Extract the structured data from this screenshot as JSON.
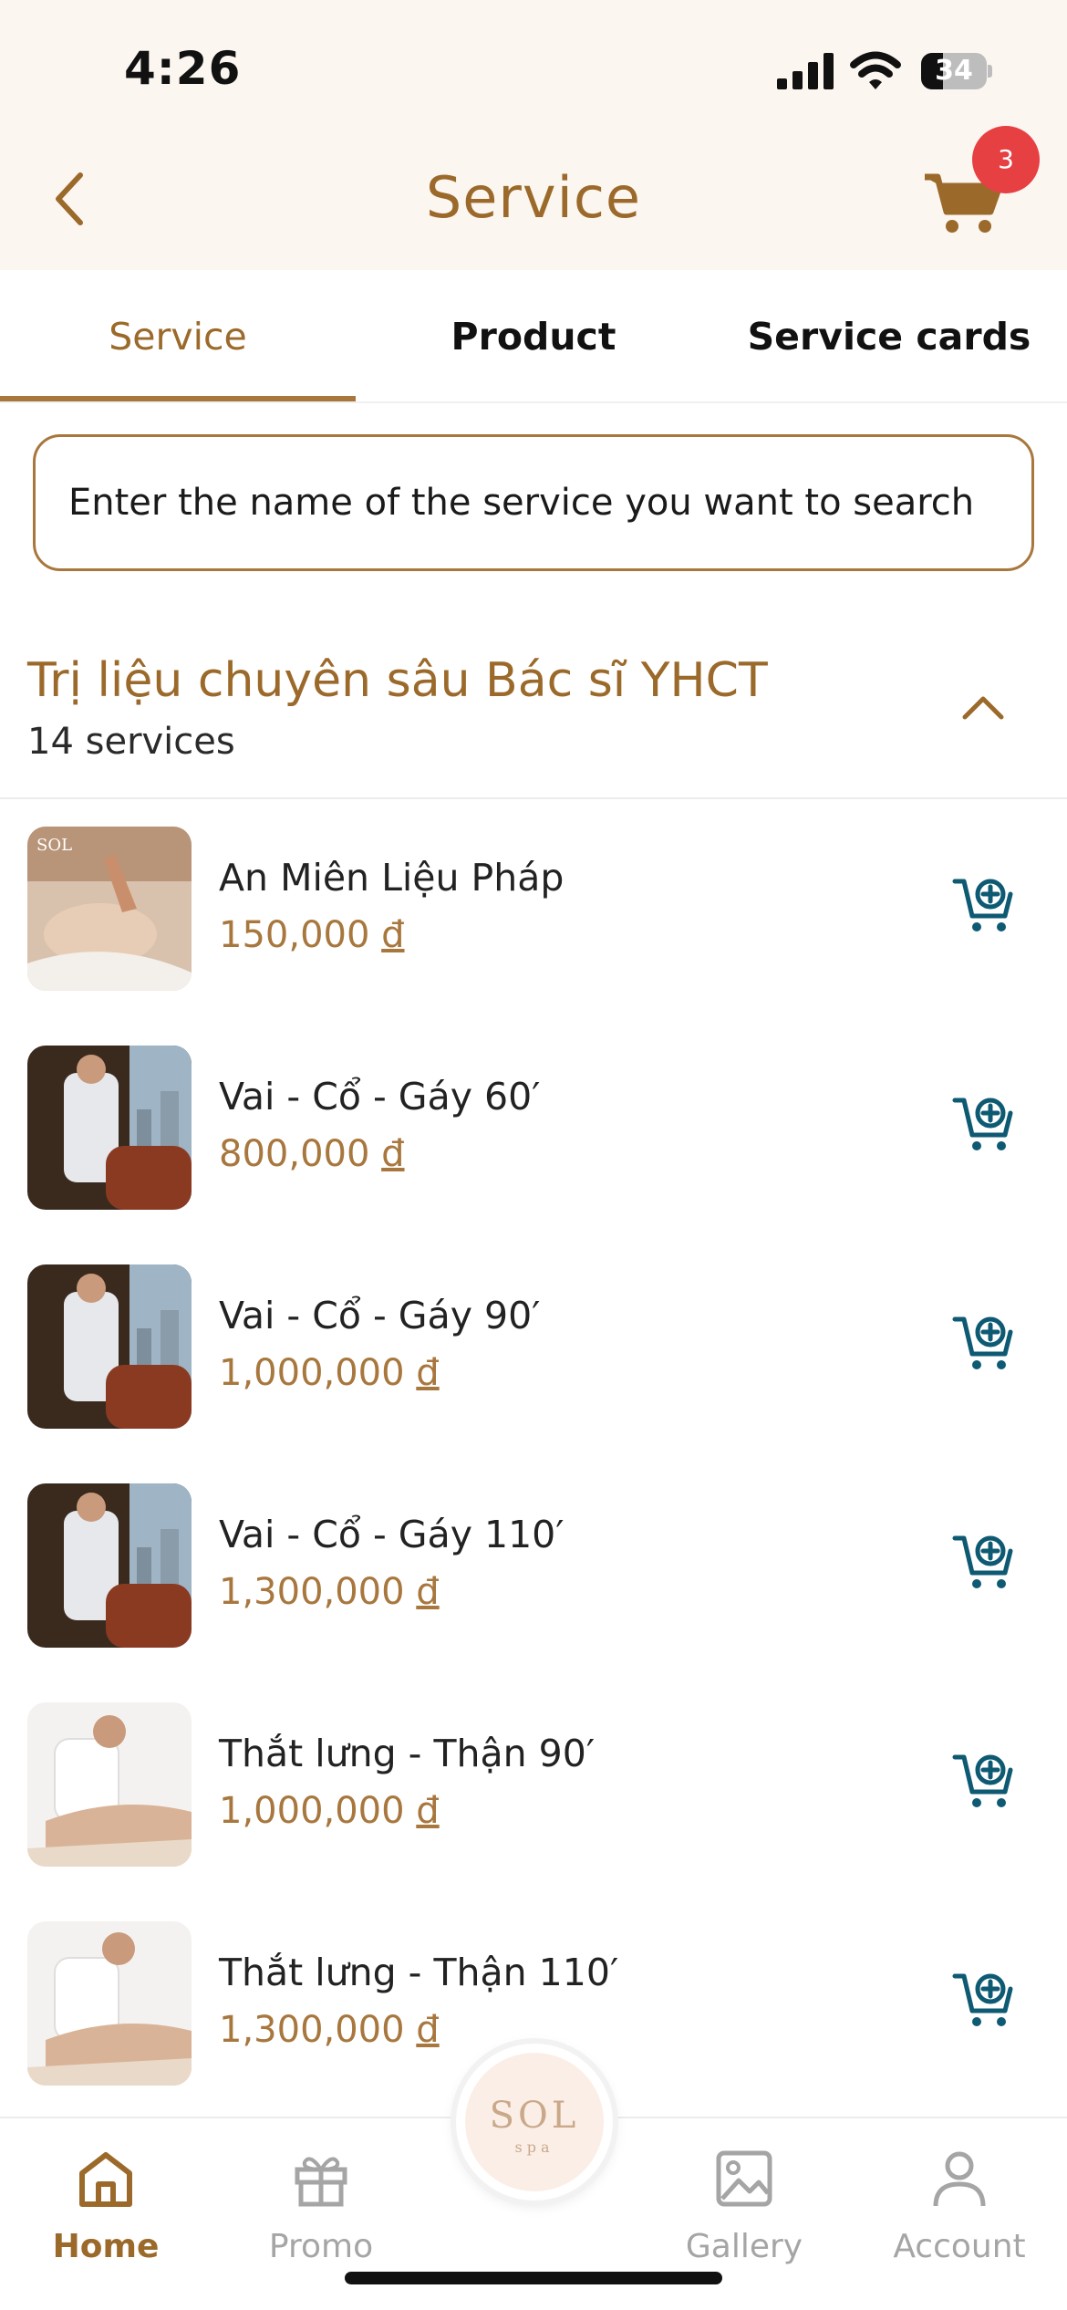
{
  "status_bar": {
    "time": "4:26",
    "battery_percent": 34,
    "battery_label": "34",
    "icons": [
      "signal-icon",
      "wifi-icon",
      "battery-icon"
    ]
  },
  "header": {
    "title": "Service",
    "back_icon": "chevron-left-icon",
    "cart_icon": "cart-icon",
    "cart_badge": "3"
  },
  "tabs": [
    {
      "label": "Service",
      "active": true
    },
    {
      "label": "Product",
      "active": false
    },
    {
      "label": "Service cards",
      "active": false
    }
  ],
  "search": {
    "placeholder": "Enter the name of the service you want to search",
    "value": ""
  },
  "category": {
    "title": "Trị liệu chuyên sâu Bác sĩ YHCT",
    "count": "14 services",
    "toggle_icon": "chevron-up-icon"
  },
  "services": [
    {
      "name": "An Miên Liệu Pháp",
      "price": "150,000",
      "currency": "đ",
      "thumb": "face-massage"
    },
    {
      "name": "Vai - Cổ - Gáy 60′",
      "price": "800,000",
      "currency": "đ",
      "thumb": "neck-massage"
    },
    {
      "name": "Vai - Cổ - Gáy 90′",
      "price": "1,000,000",
      "currency": "đ",
      "thumb": "neck-massage"
    },
    {
      "name": "Vai - Cổ - Gáy 110′",
      "price": "1,300,000",
      "currency": "đ",
      "thumb": "neck-massage"
    },
    {
      "name": "Thắt lưng - Thận 90′",
      "price": "1,000,000",
      "currency": "đ",
      "thumb": "back-massage"
    },
    {
      "name": "Thắt lưng - Thận 110′",
      "price": "1,300,000",
      "currency": "đ",
      "thumb": "back-massage"
    }
  ],
  "bottom_nav": {
    "items": [
      {
        "label": "Home",
        "icon": "home-icon",
        "active": true
      },
      {
        "label": "Promo",
        "icon": "gift-icon",
        "active": false
      },
      {
        "label": "Gallery",
        "icon": "image-icon",
        "active": false
      },
      {
        "label": "Account",
        "icon": "user-icon",
        "active": false
      }
    ],
    "center_logo": {
      "text": "SOL",
      "sub": "spa"
    }
  },
  "colors": {
    "brand": "#9b6a2b",
    "accent_border": "#a8773e",
    "header_bg": "#fcf6f1",
    "badge": "#e64043",
    "cart_add_icon": "#0e5a73",
    "inactive": "#a5a5a5"
  }
}
